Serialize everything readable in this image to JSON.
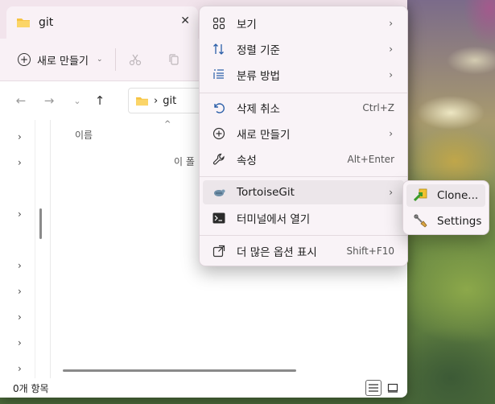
{
  "window": {
    "tab_title": "git",
    "tab_close": "✕",
    "toolbar": {
      "new_label": "새로 만들기"
    },
    "address": {
      "chevron": "›",
      "folder": "git"
    },
    "column_header": "이름",
    "empty_message": "이 폴",
    "status_text": "0개 항목"
  },
  "context_menu": {
    "items": [
      {
        "label": "보기",
        "icon": "grid-icon",
        "arrow": "›"
      },
      {
        "label": "정렬 기준",
        "icon": "sort-icon",
        "arrow": "›"
      },
      {
        "label": "분류 방법",
        "icon": "group-icon",
        "arrow": "›"
      },
      {
        "label": "삭제 취소",
        "icon": "undo-icon",
        "shortcut": "Ctrl+Z"
      },
      {
        "label": "새로 만들기",
        "icon": "new-icon",
        "arrow": "›"
      },
      {
        "label": "속성",
        "icon": "wrench-icon",
        "shortcut": "Alt+Enter"
      },
      {
        "label": "TortoiseGit",
        "icon": "tortoisegit-icon",
        "arrow": "›"
      },
      {
        "label": "터미널에서 열기",
        "icon": "terminal-icon"
      },
      {
        "label": "더 많은 옵션 표시",
        "icon": "more-options-icon",
        "shortcut": "Shift+F10"
      }
    ]
  },
  "submenu": {
    "items": [
      {
        "label": "Clone...",
        "icon": "clone-icon"
      },
      {
        "label": "Settings",
        "icon": "settings-icon"
      }
    ]
  },
  "colors": {
    "titlebar": "#f2e4ec",
    "menu_bg": "#f9f3f7",
    "folder": "#f6c343"
  }
}
